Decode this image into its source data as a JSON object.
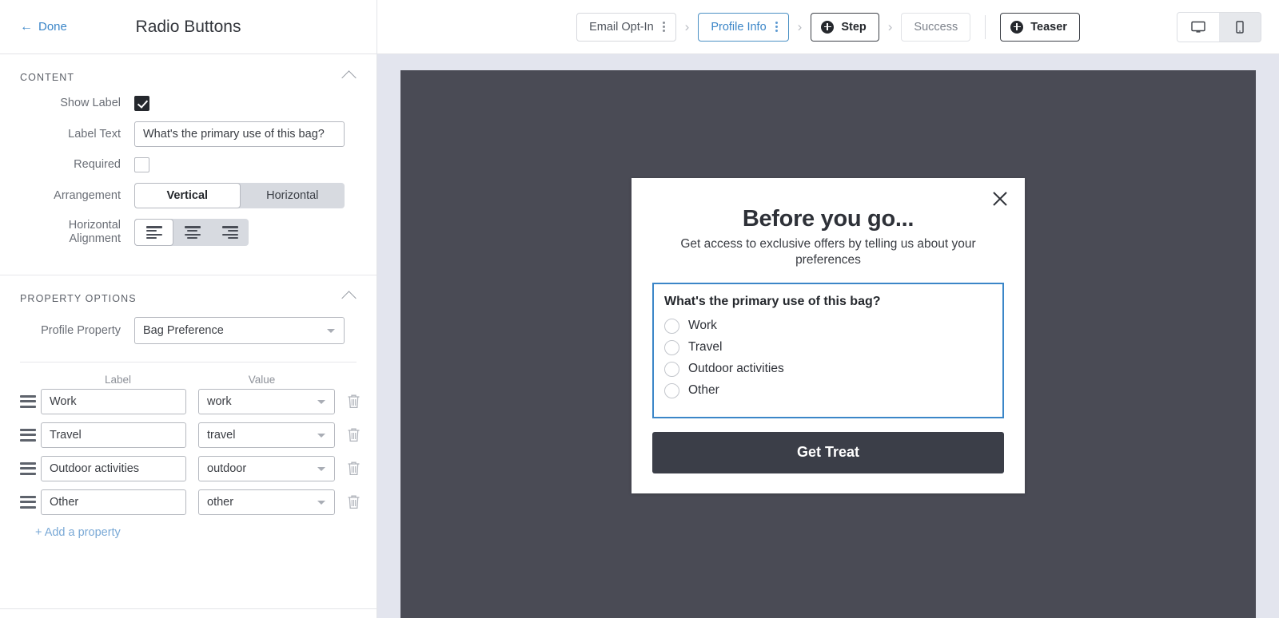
{
  "left_panel": {
    "done_label": "Done",
    "back_icon": "back-arrow-icon",
    "title": "Radio Buttons",
    "content_section": {
      "title": "CONTENT",
      "show_label": {
        "label": "Show Label",
        "checked": true
      },
      "label_text": {
        "label": "Label Text",
        "value": "What's the primary use of this bag?"
      },
      "required": {
        "label": "Required",
        "checked": false
      },
      "arrangement": {
        "label": "Arrangement",
        "options": [
          "Vertical",
          "Horizontal"
        ],
        "selected": "Vertical"
      },
      "horizontal_alignment": {
        "label_line1": "Horizontal",
        "label_line2": "Alignment",
        "options": [
          "align-left",
          "align-center",
          "align-right"
        ],
        "selected": "align-left"
      }
    },
    "property_options_section": {
      "title": "PROPERTY OPTIONS",
      "profile_property": {
        "label": "Profile Property",
        "value": "Bag Preference"
      },
      "columns": {
        "label": "Label",
        "value": "Value"
      },
      "rows": [
        {
          "label": "Work",
          "value": "work"
        },
        {
          "label": "Travel",
          "value": "travel"
        },
        {
          "label": "Outdoor activities",
          "value": "outdoor"
        },
        {
          "label": "Other",
          "value": "other"
        }
      ],
      "add_property_label": "+ Add a property"
    }
  },
  "topbar": {
    "steps": [
      {
        "label": "Email Opt-In",
        "state": "normal",
        "has_kebab": true,
        "has_plus": false
      },
      {
        "label": "Profile Info",
        "state": "active",
        "has_kebab": true,
        "has_plus": false
      },
      {
        "label": "Step",
        "state": "dark",
        "has_kebab": false,
        "has_plus": true
      },
      {
        "label": "Success",
        "state": "plain",
        "has_kebab": false,
        "has_plus": false
      }
    ],
    "teaser": {
      "label": "Teaser",
      "has_plus": true
    },
    "arrow_glyph": "›",
    "devices": [
      {
        "name": "desktop",
        "active": true
      },
      {
        "name": "mobile",
        "active": false
      }
    ]
  },
  "preview": {
    "close_icon": "close-icon",
    "headline": "Before you go...",
    "body": "Get access to exclusive offers by telling us about your preferences",
    "question": "What's the primary use of this bag?",
    "radio_options": [
      "Work",
      "Travel",
      "Outdoor activities",
      "Other"
    ],
    "cta_label": "Get Treat"
  },
  "colors": {
    "accent_blue": "#3b86c8",
    "canvas_bg": "#e3e5ee",
    "viewport_bg": "#4a4b55",
    "cta_bg": "#3b3e48",
    "segment_bg": "#d7dae0"
  }
}
